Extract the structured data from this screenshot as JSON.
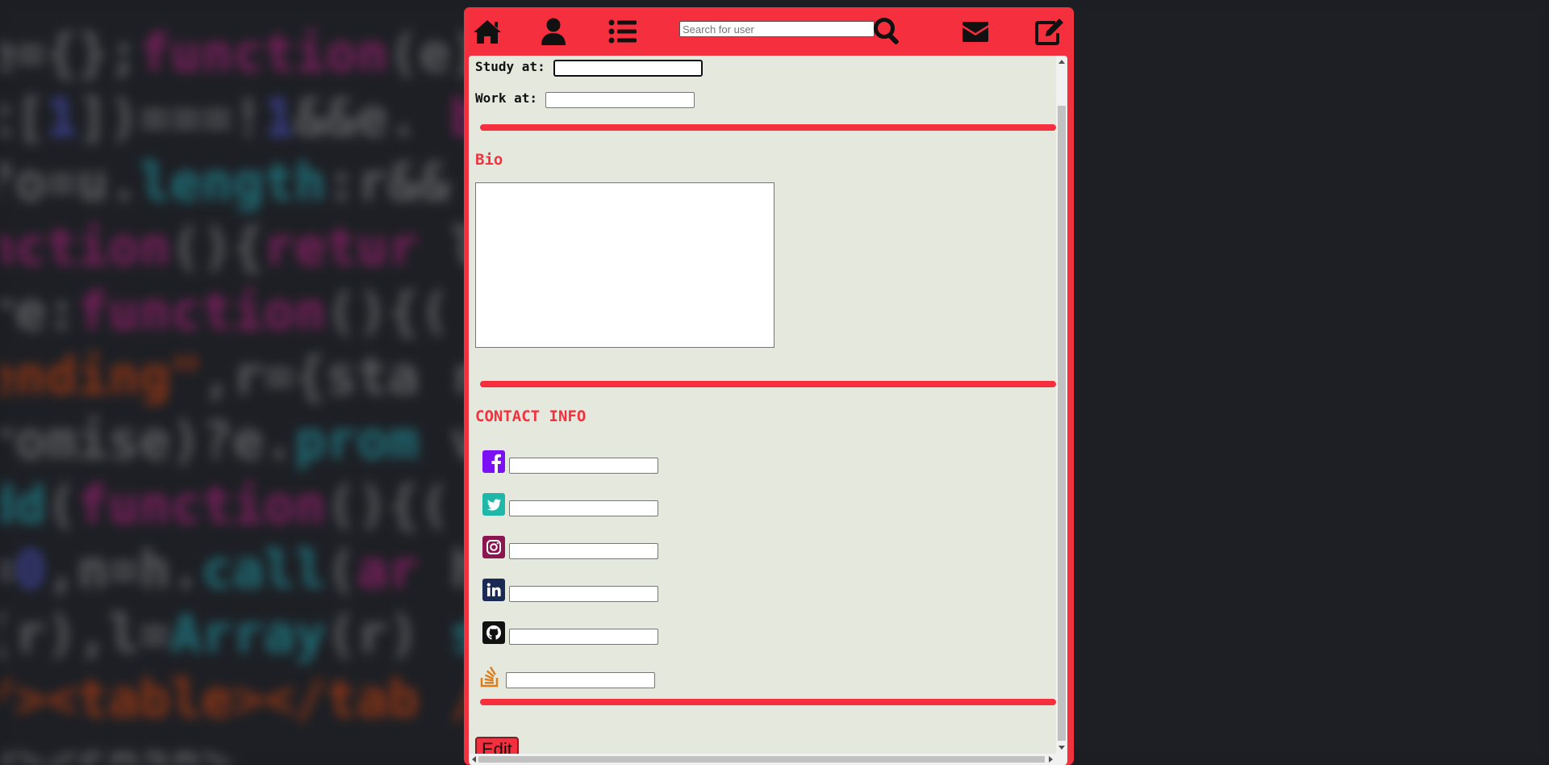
{
  "navbar": {
    "icons": [
      "home-icon",
      "user-icon",
      "list-icon",
      "search-icon",
      "envelope-icon",
      "edit-icon"
    ],
    "search_placeholder": "Search for user"
  },
  "profile_form": {
    "study_label": "Study at:",
    "study_value": "",
    "work_label": "Work at:",
    "work_value": "",
    "bio_title": "Bio",
    "bio_value": "",
    "contact_title": "CONTACT INFO",
    "contacts": [
      {
        "icon": "facebook-icon",
        "value": "",
        "color": "#7b10f5"
      },
      {
        "icon": "twitter-icon",
        "value": "",
        "color": "#1fb8a8"
      },
      {
        "icon": "instagram-icon",
        "value": "",
        "color": "#8a1550"
      },
      {
        "icon": "linkedin-icon",
        "value": "",
        "color": "#1b2a55"
      },
      {
        "icon": "github-icon",
        "value": "",
        "color": "#111111"
      },
      {
        "icon": "stackoverflow-icon",
        "value": "",
        "color": "#e07b1a"
      }
    ],
    "edit_label": "Edit"
  },
  "colors": {
    "accent": "#f4323f",
    "panel_bg": "#e4e8dd"
  }
}
